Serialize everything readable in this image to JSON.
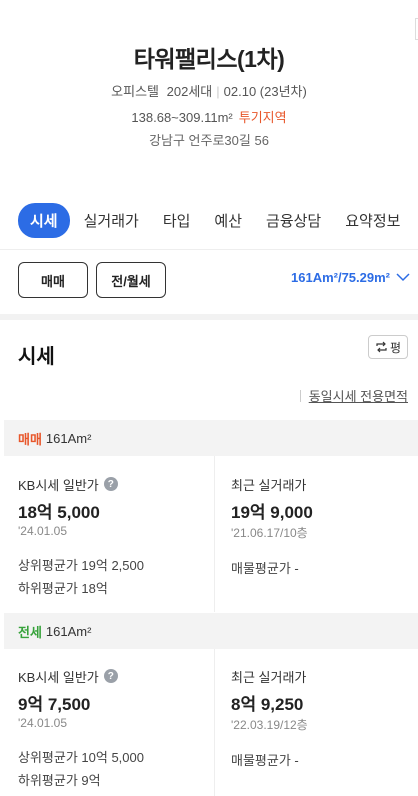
{
  "header": {
    "title": "타워팰리스(1차)",
    "type": "오피스텔",
    "households": "202세대",
    "built": "02.10 (23년차)",
    "area_range": "138.68~309.11m²",
    "zone_tag": "투기지역",
    "address": "강남구 언주로30길 56"
  },
  "tabs": [
    {
      "label": "시세",
      "active": true
    },
    {
      "label": "실거래가"
    },
    {
      "label": "타입"
    },
    {
      "label": "예산"
    },
    {
      "label": "금융상담"
    },
    {
      "label": "요약정보"
    }
  ],
  "filters": {
    "sale_btn": "매매",
    "rent_btn": "전/월세",
    "area_selected": "161Am²/75.29m²"
  },
  "section": {
    "title": "시세",
    "unit_toggle": "평",
    "same_area_link": "동일시세 전용면적"
  },
  "sale": {
    "kind": "매매",
    "area": "161Am²",
    "kb_label": "KB시세 일반가",
    "kb_price": "18억 5,000",
    "kb_date": "'24.01.05",
    "upper_avg": "상위평균가 19억 2,500",
    "lower_avg": "하위평균가 18억",
    "recent_label": "최근 실거래가",
    "recent_price": "19억 9,000",
    "recent_date": "'21.06.17/10층",
    "listing_avg": "매물평균가 -"
  },
  "jeonse": {
    "kind": "전세",
    "area": "161Am²",
    "kb_label": "KB시세 일반가",
    "kb_price": "9억 7,500",
    "kb_date": "'24.01.05",
    "upper_avg": "상위평균가 10억 5,000",
    "lower_avg": "하위평균가 9억",
    "recent_label": "최근 실거래가",
    "recent_price": "8억 9,250",
    "recent_date": "'22.03.19/12층",
    "listing_avg": "매물평균가 -"
  },
  "colors": {
    "accent": "#2c6ce5",
    "sale": "#e8562a",
    "rent": "#36a23a"
  },
  "icons": [
    "help-icon",
    "chevron-down-icon",
    "swap-icon"
  ]
}
